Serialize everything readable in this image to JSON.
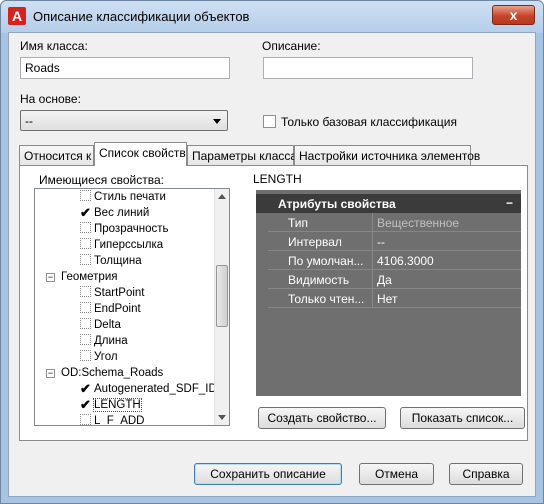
{
  "window": {
    "title": "Описание классификации объектов",
    "app_icon_letter": "A",
    "close_symbol": "x"
  },
  "form": {
    "class_name_label": "Имя класса:",
    "class_name_value": "Roads",
    "description_label": "Описание:",
    "description_value": "",
    "based_on_label": "На основе:",
    "based_on_value": "--",
    "base_only_label": "Только базовая классификация",
    "base_only_checked": false
  },
  "tabs": [
    {
      "label": "Относится к",
      "active": false
    },
    {
      "label": "Список свойств",
      "active": true
    },
    {
      "label": "Параметры класса",
      "active": false
    },
    {
      "label": "Настройки источника элементов",
      "active": false
    }
  ],
  "tree": {
    "label": "Имеющиеся свойства:",
    "items": [
      {
        "label": "Стиль печати",
        "checked": false,
        "level": 2
      },
      {
        "label": "Вес линий",
        "checked": true,
        "level": 2
      },
      {
        "label": "Прозрачность",
        "checked": false,
        "level": 2
      },
      {
        "label": "Гиперссылка",
        "checked": false,
        "level": 2
      },
      {
        "label": "Толщина",
        "checked": false,
        "level": 2
      },
      {
        "label": "Геометрия",
        "group": true,
        "expander": "−",
        "level": 1
      },
      {
        "label": "StartPoint",
        "checked": false,
        "level": 2
      },
      {
        "label": "EndPoint",
        "checked": false,
        "level": 2
      },
      {
        "label": "Delta",
        "checked": false,
        "level": 2
      },
      {
        "label": "Длина",
        "checked": false,
        "level": 2
      },
      {
        "label": "Угол",
        "checked": false,
        "level": 2
      },
      {
        "label": "OD:Schema_Roads",
        "group": true,
        "expander": "−",
        "level": 1
      },
      {
        "label": "Autogenerated_SDF_ID",
        "checked": true,
        "level": 2
      },
      {
        "label": "LENGTH",
        "checked": true,
        "selected": true,
        "level": 2
      },
      {
        "label": "L_F_ADD",
        "checked": false,
        "level": 2
      }
    ]
  },
  "property_panel": {
    "selected_name": "LENGTH",
    "header": "Атрибуты свойства",
    "collapse_symbol": "−",
    "rows": [
      {
        "key": "Тип",
        "value": "Вещественное",
        "dim": true
      },
      {
        "key": "Интервал",
        "value": "--",
        "dim": false
      },
      {
        "key": "По умолчан...",
        "value": "4106.3000",
        "dim": false
      },
      {
        "key": "Видимость",
        "value": "Да",
        "dim": false
      },
      {
        "key": "Только чтен...",
        "value": "Нет",
        "dim": false
      }
    ]
  },
  "buttons": {
    "create_property": "Создать свойство...",
    "show_list": "Показать список...",
    "save_description": "Сохранить описание",
    "cancel": "Отмена",
    "help": "Справка"
  }
}
